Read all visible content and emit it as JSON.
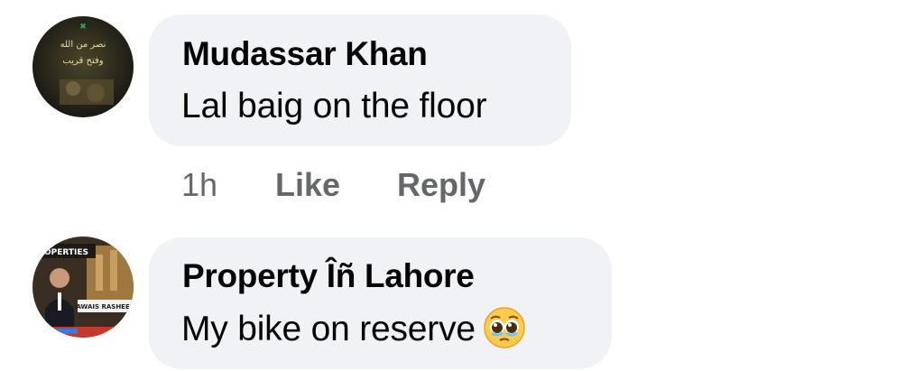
{
  "comments": [
    {
      "author": "Mudassar Khan",
      "text": "Lal baig on the floor",
      "avatar_text_1": "نصر من الله",
      "avatar_text_2": "وفتح قريب",
      "time": "1h",
      "like_label": "Like",
      "reply_label": "Reply"
    },
    {
      "author": "Property Îñ Lahore",
      "text": "My bike on reserve",
      "emoji": "pleading-face",
      "avatar_text_1": "ROPERTIES",
      "avatar_text_2": "AWAIS RASHEED"
    }
  ],
  "colors": {
    "bubble": "#f0f2f5",
    "meta": "#65676b",
    "text": "#050505"
  }
}
